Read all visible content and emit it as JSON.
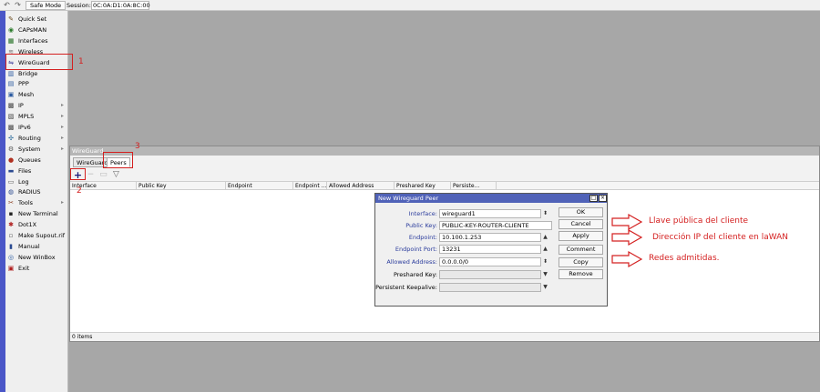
{
  "toolbar": {
    "back_icon": "undo-arrow-icon",
    "forward_icon": "redo-arrow-icon",
    "safe_mode_label": "Safe Mode",
    "session_label": "Session:",
    "session_value": "0C:0A:D1:0A:8C:00"
  },
  "sidebar": {
    "items": [
      {
        "label": "Quick Set",
        "icon": "wand-icon",
        "glyph": "✎",
        "color": "#6a4a1a",
        "arrow": false
      },
      {
        "label": "CAPsMAN",
        "icon": "antenna-icon",
        "glyph": "◉",
        "color": "#2a7a2a",
        "arrow": false
      },
      {
        "label": "Interfaces",
        "icon": "network-card-icon",
        "glyph": "▦",
        "color": "#1a6a1a",
        "arrow": false
      },
      {
        "label": "Wireless",
        "icon": "wifi-icon",
        "glyph": "≋",
        "color": "#777777",
        "arrow": false
      },
      {
        "label": "WireGuard",
        "icon": "wireguard-icon",
        "glyph": "⇋",
        "color": "#3a3a9a",
        "arrow": false
      },
      {
        "label": "Bridge",
        "icon": "bridge-icon",
        "glyph": "▥",
        "color": "#2a5aa0",
        "arrow": false
      },
      {
        "label": "PPP",
        "icon": "ppp-icon",
        "glyph": "▤",
        "color": "#2a5aa0",
        "arrow": false
      },
      {
        "label": "Mesh",
        "icon": "mesh-icon",
        "glyph": "▣",
        "color": "#2a5aa0",
        "arrow": false
      },
      {
        "label": "IP",
        "icon": "ip-icon",
        "glyph": "▩",
        "color": "#444444",
        "arrow": true
      },
      {
        "label": "MPLS",
        "icon": "mpls-icon",
        "glyph": "▧",
        "color": "#444444",
        "arrow": true
      },
      {
        "label": "IPv6",
        "icon": "ipv6-icon",
        "glyph": "▩",
        "color": "#444444",
        "arrow": true
      },
      {
        "label": "Routing",
        "icon": "routing-icon",
        "glyph": "✣",
        "color": "#2a6a9a",
        "arrow": true
      },
      {
        "label": "System",
        "icon": "gear-icon",
        "glyph": "⚙",
        "color": "#555555",
        "arrow": true
      },
      {
        "label": "Queues",
        "icon": "queues-icon",
        "glyph": "●",
        "color": "#b03020",
        "arrow": false
      },
      {
        "label": "Files",
        "icon": "folder-icon",
        "glyph": "▬",
        "color": "#2a4a90",
        "arrow": false
      },
      {
        "label": "Log",
        "icon": "log-icon",
        "glyph": "▭",
        "color": "#555555",
        "arrow": false
      },
      {
        "label": "RADIUS",
        "icon": "radius-icon",
        "glyph": "◍",
        "color": "#2a4a90",
        "arrow": false
      },
      {
        "label": "Tools",
        "icon": "tools-icon",
        "glyph": "✂",
        "color": "#8a3a1a",
        "arrow": true
      },
      {
        "label": "New Terminal",
        "icon": "terminal-icon",
        "glyph": "▪",
        "color": "#222222",
        "arrow": false
      },
      {
        "label": "Dot1X",
        "icon": "dot1x-icon",
        "glyph": "✱",
        "color": "#b02020",
        "arrow": false
      },
      {
        "label": "Make Supout.rif",
        "icon": "support-file-icon",
        "glyph": "▫",
        "color": "#555555",
        "arrow": false
      },
      {
        "label": "Manual",
        "icon": "manual-icon",
        "glyph": "▮",
        "color": "#2a4a90",
        "arrow": false
      },
      {
        "label": "New WinBox",
        "icon": "winbox-icon",
        "glyph": "◎",
        "color": "#2a5aa0",
        "arrow": false
      },
      {
        "label": "Exit",
        "icon": "exit-icon",
        "glyph": "▣",
        "color": "#b02020",
        "arrow": false
      }
    ]
  },
  "wireguard_window": {
    "title": "WireGuard",
    "tabs": [
      "WireGuard",
      "Peers"
    ],
    "columns": [
      "Interface",
      "Public Key",
      "Endpoint",
      "Endpoint ...",
      "Allowed Address",
      "Preshared Key",
      "Persiste..."
    ],
    "status": "0 items"
  },
  "peer_dialog": {
    "title": "New Wireguard Peer",
    "fields": [
      {
        "label": "Interface:",
        "value": "wireguard1",
        "dropdown": "spin"
      },
      {
        "label": "Public Key:",
        "value": "PUBLIC-KEY-ROUTER-CLIENTE",
        "dropdown": ""
      },
      {
        "label": "Endpoint:",
        "value": "10.100.1.253",
        "dropdown": "up"
      },
      {
        "label": "Endpoint Port:",
        "value": "13231",
        "dropdown": "up"
      },
      {
        "label": "Allowed Address:",
        "value": "0.0.0.0/0",
        "dropdown": "spin"
      },
      {
        "label": "Preshared Key:",
        "value": "",
        "dropdown": "down"
      },
      {
        "label": "Persistent Keepalive:",
        "value": "",
        "dropdown": "down"
      }
    ],
    "buttons": [
      "OK",
      "Cancel",
      "Apply",
      "Comment",
      "Copy",
      "Remove"
    ]
  },
  "annotations": {
    "numbers": [
      "1",
      "2",
      "3"
    ],
    "notes": [
      "Llave pública del cliente",
      "Dirección IP del cliente en laWAN",
      "Redes admitidas."
    ],
    "color": "#d42020"
  },
  "colors": {
    "sidebar_band": "#4a56c7",
    "dialog_title": "#5062b8",
    "workspace": "#a7a7a7"
  }
}
